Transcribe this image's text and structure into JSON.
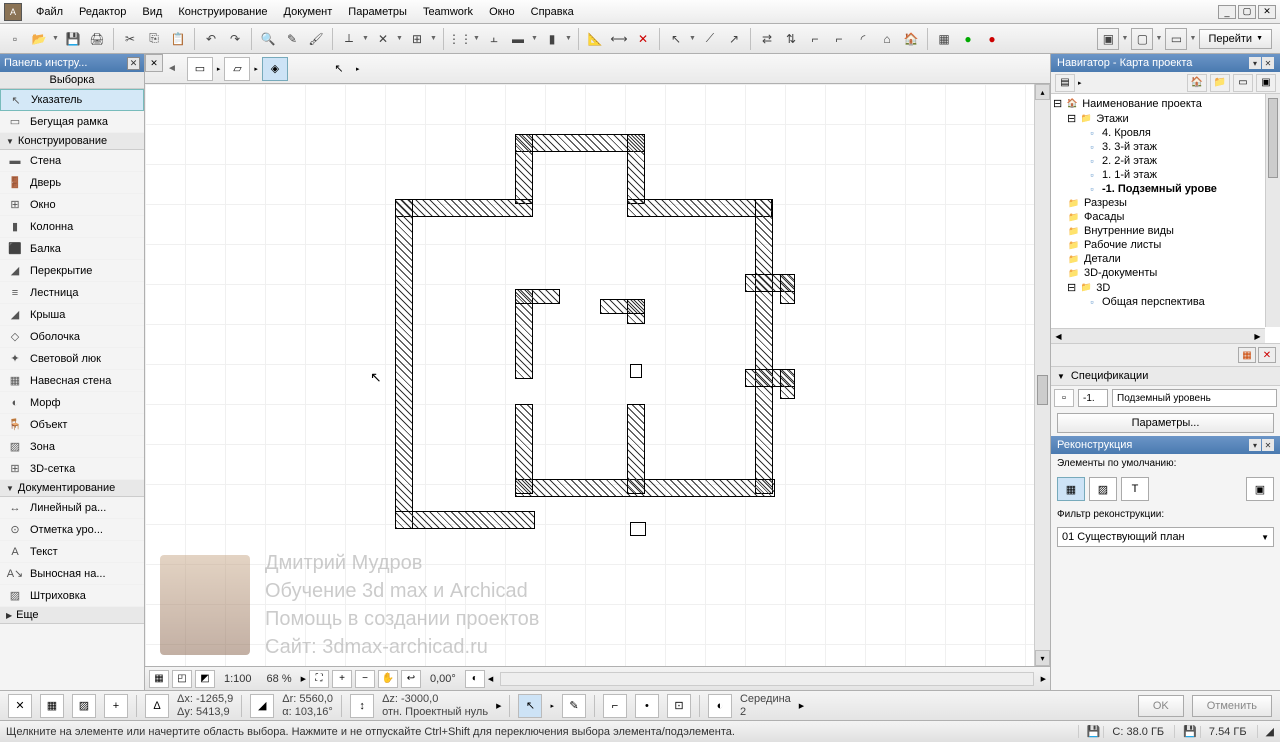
{
  "menu": {
    "items": [
      "Файл",
      "Редактор",
      "Вид",
      "Конструирование",
      "Документ",
      "Параметры",
      "Teamwork",
      "Окно",
      "Справка"
    ]
  },
  "toolbox": {
    "title": "Панель инстру...",
    "sections": {
      "select": "Выборка",
      "select_items": [
        {
          "icon": "↖",
          "label": "Указатель",
          "sel": true
        },
        {
          "icon": "▭",
          "label": "Бегущая рамка"
        }
      ],
      "design": "Конструирование",
      "design_items": [
        {
          "icon": "▬",
          "label": "Стена"
        },
        {
          "icon": "🚪",
          "label": "Дверь"
        },
        {
          "icon": "⊞",
          "label": "Окно"
        },
        {
          "icon": "▮",
          "label": "Колонна"
        },
        {
          "icon": "⬛",
          "label": "Балка"
        },
        {
          "icon": "◢",
          "label": "Перекрытие"
        },
        {
          "icon": "≡",
          "label": "Лестница"
        },
        {
          "icon": "◢",
          "label": "Крыша"
        },
        {
          "icon": "◇",
          "label": "Оболочка"
        },
        {
          "icon": "✦",
          "label": "Световой люк"
        },
        {
          "icon": "▦",
          "label": "Навесная стена"
        },
        {
          "icon": "◐",
          "label": "Морф"
        },
        {
          "icon": "🪑",
          "label": "Объект"
        },
        {
          "icon": "▨",
          "label": "Зона"
        },
        {
          "icon": "⊞",
          "label": "3D-сетка"
        }
      ],
      "doc": "Документирование",
      "doc_items": [
        {
          "icon": "↔",
          "label": "Линейный ра..."
        },
        {
          "icon": "⊙",
          "label": "Отметка уро..."
        },
        {
          "icon": "A",
          "label": "Текст"
        },
        {
          "icon": "A↘",
          "label": "Выносная на..."
        },
        {
          "icon": "▨",
          "label": "Штриховка"
        }
      ],
      "more": "Еще"
    }
  },
  "navigator": {
    "title": "Навигатор - Карта проекта",
    "project": "Наименование проекта",
    "floors_label": "Этажи",
    "floors": [
      "4. Кровля",
      "3. 3-й этаж",
      "2. 2-й этаж",
      "1. 1-й этаж",
      "-1. Подземный урове"
    ],
    "active_floor": 4,
    "categories": [
      "Разрезы",
      "Фасады",
      "Внутренние виды",
      "Рабочие листы",
      "Детали",
      "3D-документы"
    ],
    "threed": "3D",
    "persp": "Общая перспектива"
  },
  "spec": {
    "title": "Спецификации",
    "level_code": "-1.",
    "level_name": "Подземный уровень",
    "params_btn": "Параметры..."
  },
  "recon": {
    "title": "Реконструкция",
    "default_label": "Элементы по умолчанию:",
    "filter_label": "Фильтр реконструкции:",
    "filter_value": "01 Существующий план"
  },
  "ruler": {
    "scale": "1:100",
    "zoom": "68 %",
    "angle": "0,00°"
  },
  "coords": {
    "dx": "Δx: -1265,9",
    "dy": "Δy: 5413,9",
    "dr": "Δr: 5560,0",
    "da": "α: 103,16°",
    "dz": "Δz: -3000,0",
    "ref": "отн. Проектный нуль",
    "mid": "Середина",
    "mid_n": "2"
  },
  "buttons": {
    "go": "Перейти",
    "ok": "OK",
    "cancel": "Отменить"
  },
  "status": {
    "hint": "Щелкните на элементе или начертите область выбора. Нажмите и не отпускайте Ctrl+Shift для переключения выбора элемента/подэлемента.",
    "disk": "C: 38.0 ГБ",
    "disk2": "7.54 ГБ"
  },
  "watermark": {
    "l1": "Дмитрий Мудров",
    "l2": "Обучение 3d max и Archicad",
    "l3": "Помощь в создании проектов",
    "l4": "Сайт: 3dmax-archicad.ru"
  },
  "xclose": {
    "a": "▦",
    "b": "✕"
  }
}
